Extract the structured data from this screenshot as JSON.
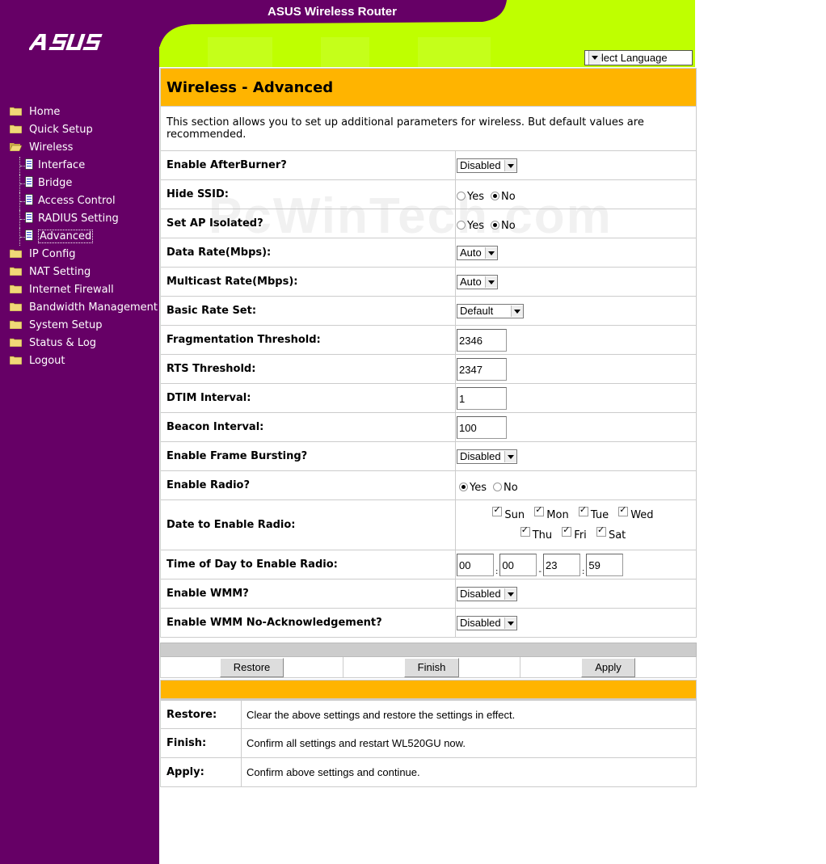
{
  "app_title": "ASUS Wireless Router",
  "brand": "ASUS",
  "language_select": "Select Language",
  "nav": [
    {
      "label": "Home",
      "icon": "folder-icon"
    },
    {
      "label": "Quick Setup",
      "icon": "folder-icon"
    },
    {
      "label": "Wireless",
      "icon": "open-folder-icon",
      "children": [
        {
          "label": "Interface",
          "icon": "page-icon"
        },
        {
          "label": "Bridge",
          "icon": "page-icon"
        },
        {
          "label": "Access Control",
          "icon": "page-icon"
        },
        {
          "label": "RADIUS Setting",
          "icon": "page-icon"
        },
        {
          "label": "Advanced",
          "icon": "page-icon",
          "selected": true
        }
      ]
    },
    {
      "label": "IP Config",
      "icon": "folder-icon"
    },
    {
      "label": "NAT Setting",
      "icon": "folder-icon"
    },
    {
      "label": "Internet Firewall",
      "icon": "folder-icon"
    },
    {
      "label": "Bandwidth Management",
      "icon": "folder-icon"
    },
    {
      "label": "System Setup",
      "icon": "folder-icon"
    },
    {
      "label": "Status & Log",
      "icon": "folder-icon"
    },
    {
      "label": "Logout",
      "icon": "folder-icon"
    }
  ],
  "page": {
    "title": "Wireless - Advanced",
    "description": "This section allows you to set up additional parameters for wireless. But default values are recommended."
  },
  "fields": {
    "afterburner": {
      "label": "Enable AfterBurner?",
      "value": "Disabled"
    },
    "hide_ssid": {
      "label": "Hide SSID:",
      "yes": "Yes",
      "no": "No",
      "selected": "No"
    },
    "ap_isolated": {
      "label": "Set AP Isolated?",
      "yes": "Yes",
      "no": "No",
      "selected": "No"
    },
    "data_rate": {
      "label": "Data Rate(Mbps):",
      "value": "Auto"
    },
    "multicast_rate": {
      "label": "Multicast Rate(Mbps):",
      "value": "Auto"
    },
    "basic_rate_set": {
      "label": "Basic Rate Set:",
      "value": "Default"
    },
    "frag_threshold": {
      "label": "Fragmentation Threshold:",
      "value": "2346"
    },
    "rts_threshold": {
      "label": "RTS Threshold:",
      "value": "2347"
    },
    "dtim_interval": {
      "label": "DTIM Interval:",
      "value": "1"
    },
    "beacon_interval": {
      "label": "Beacon Interval:",
      "value": "100"
    },
    "frame_bursting": {
      "label": "Enable Frame Bursting?",
      "value": "Disabled"
    },
    "enable_radio": {
      "label": "Enable Radio?",
      "yes": "Yes",
      "no": "No",
      "selected": "Yes"
    },
    "date_radio": {
      "label": "Date to Enable Radio:",
      "days": [
        "Sun",
        "Mon",
        "Tue",
        "Wed",
        "Thu",
        "Fri",
        "Sat"
      ],
      "checked": [
        true,
        true,
        true,
        true,
        true,
        true,
        true
      ]
    },
    "time_radio": {
      "label": "Time of Day to Enable Radio:",
      "start_hour": "00",
      "start_min": "00",
      "end_hour": "23",
      "end_min": "59",
      "sep_colon": ":",
      "sep_dash": "-"
    },
    "wmm": {
      "label": "Enable WMM?",
      "value": "Disabled"
    },
    "wmm_noack": {
      "label": "Enable WMM No-Acknowledgement?",
      "value": "Disabled"
    }
  },
  "buttons": {
    "restore": "Restore",
    "finish": "Finish",
    "apply": "Apply"
  },
  "help": [
    {
      "term": "Restore:",
      "text": "Clear the above settings and restore the settings in effect."
    },
    {
      "term": "Finish:",
      "text": "Confirm all settings and restart WL520GU now."
    },
    {
      "term": "Apply:",
      "text": "Confirm above settings and continue."
    }
  ],
  "watermark": "PcWinTech.com",
  "colors": {
    "sidebar": "#660066",
    "header_green": "#bfff00",
    "title_orange": "#ffb400"
  }
}
